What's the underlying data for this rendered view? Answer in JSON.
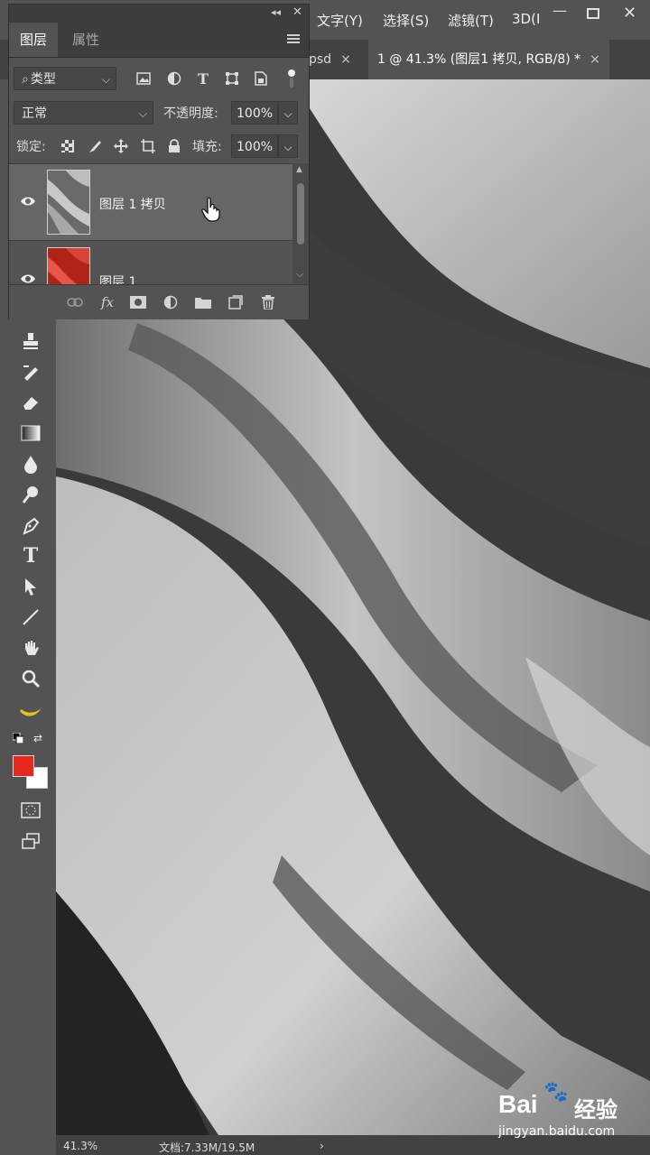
{
  "menu": {
    "items": [
      "文字(Y)",
      "选择(S)",
      "滤镜(T)",
      "3D(I"
    ],
    "window_controls": [
      "minimize",
      "maximize",
      "close"
    ]
  },
  "doc_tabs": [
    {
      "label": "psd",
      "close": "×",
      "active": false
    },
    {
      "label": "1 @ 41.3% (图层1 拷贝, RGB/8) *",
      "close": "×",
      "active": true
    }
  ],
  "layers_panel": {
    "top_icons": {
      "collapse": "◂◂",
      "close": "✕"
    },
    "tabs": [
      {
        "label": "图层",
        "active": true
      },
      {
        "label": "属性",
        "active": false
      }
    ],
    "menu_icon": "panel-menu-icon",
    "filter_dropdown": "类型",
    "filter_icons": [
      "image-filter-icon",
      "adjustment-filter-icon",
      "type-filter-icon",
      "shape-filter-icon",
      "smart-object-filter-icon",
      "filter-toggle-icon"
    ],
    "blend_mode": "正常",
    "opacity_label": "不透明度:",
    "opacity_value": "100%",
    "lock_label": "锁定:",
    "lock_icons": [
      "lock-transparent-icon",
      "lock-brush-icon",
      "lock-position-icon",
      "lock-artboard-icon",
      "lock-all-icon"
    ],
    "fill_label": "填充:",
    "fill_value": "100%",
    "layers": [
      {
        "name": "图层 1 拷贝",
        "visible": true,
        "selected": true,
        "thumb": "gray-silk"
      },
      {
        "name": "图层 1",
        "visible": true,
        "selected": false,
        "thumb": "red-silk"
      }
    ],
    "footer_icons": [
      "link-icon",
      "fx-icon",
      "mask-icon",
      "adjustment-icon",
      "folder-icon",
      "new-layer-icon",
      "trash-icon"
    ]
  },
  "toolbar": {
    "tools": [
      "clone-stamp-icon",
      "history-brush-icon",
      "eraser-icon",
      "gradient-icon",
      "blur-icon",
      "dodge-icon",
      "pen-icon",
      "type-icon",
      "path-selection-icon",
      "line-icon",
      "hand-icon",
      "zoom-icon",
      "banana-icon"
    ],
    "foreground_color": "#e8281e",
    "background_color": "#ffffff"
  },
  "status": {
    "zoom": "41.3%",
    "doc_info": "文档:7.33M/19.5M",
    "arrow": "›"
  },
  "watermark": {
    "brand": "Bai",
    "brand2": "经验",
    "url": "jingyan.baidu.com"
  }
}
